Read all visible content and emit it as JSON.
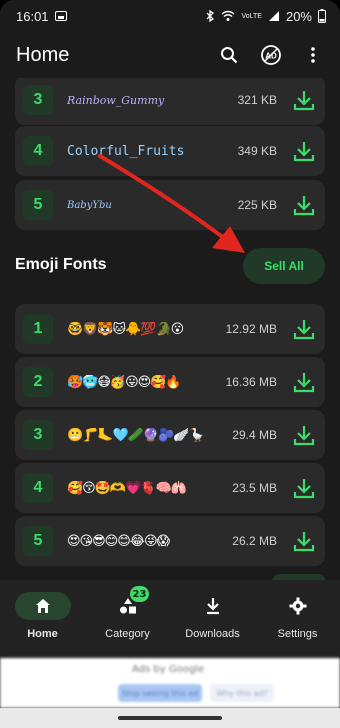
{
  "status_bar": {
    "time": "16:01",
    "battery": "20%"
  },
  "app_bar": {
    "title": "Home"
  },
  "font_rows": [
    {
      "number": "3",
      "preview": "Rainbow_Gummy",
      "size": "321 KB"
    },
    {
      "number": "4",
      "preview": "Colorful_Fruits",
      "size": "349 KB"
    },
    {
      "number": "5",
      "preview": "BabyYbu",
      "size": "225 KB"
    }
  ],
  "emoji_section": {
    "title": "Emoji Fonts",
    "see_all_label": "Sell All"
  },
  "emoji_rows": [
    {
      "number": "1",
      "preview": "🤓🦁🐯🐱🐥💯🐊😮",
      "size": "12.92 MB"
    },
    {
      "number": "2",
      "preview": "🥵🥶😷🥳😛😍🥰🔥",
      "size": "16.36 MB"
    },
    {
      "number": "3",
      "preview": "😬🦵🦶🩵🥒🔮🫐🪽🪿",
      "size": "29.4 MB"
    },
    {
      "number": "4",
      "preview": "🥰😚🤩🫶💗🫀🧠🫁",
      "size": "23.5 MB"
    },
    {
      "number": "5",
      "preview": "😍😘😎😊😊😂😜😱",
      "size": "26.2 MB"
    }
  ],
  "bottom_nav": [
    {
      "label": "Home",
      "active": true
    },
    {
      "label": "Category",
      "badge": "23"
    },
    {
      "label": "Downloads"
    },
    {
      "label": "Settings"
    }
  ],
  "ad": {
    "title": "Ads by Google",
    "button_primary": "Stop seeing this ad",
    "button_secondary": "Why this ad?"
  },
  "colors": {
    "accent": "#3ddc6a",
    "background": "#1b1b1b",
    "card": "#2a2a2a",
    "arrow": "#e0261f"
  }
}
